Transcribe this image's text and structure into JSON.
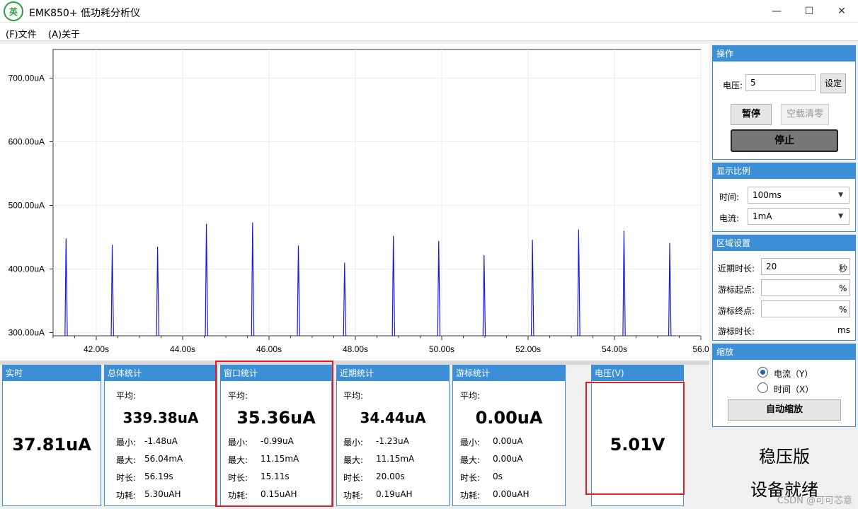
{
  "window": {
    "title": "EMK850+ 低功耗分析仪",
    "logo_text": "英",
    "controls": {
      "minimize": "—",
      "maximize": "☐",
      "close": "✕"
    }
  },
  "menu": {
    "file": "(F)文件",
    "about": "(A)关于"
  },
  "chart_data": {
    "type": "line",
    "title": "",
    "xlabel": "",
    "ylabel": "",
    "y_tick_labels": [
      "700.00uA",
      "600.00uA",
      "500.00uA",
      "400.00uA",
      "300.00uA"
    ],
    "y_ticks": [
      700,
      600,
      500,
      400,
      300
    ],
    "x_tick_labels": [
      "42.00s",
      "44.00s",
      "46.00s",
      "48.00s",
      "50.00s",
      "52.00s",
      "54.00s",
      "56.0"
    ],
    "x_ticks": [
      42,
      44,
      46,
      48,
      50,
      52,
      54,
      56
    ],
    "xlim": [
      41.0,
      56.0
    ],
    "ylim": [
      295,
      745
    ],
    "grid": true,
    "series": [
      {
        "color": "#1a1ad8",
        "baseline": 300,
        "peaks": [
          {
            "x": 41.3,
            "y": 448
          },
          {
            "x": 42.37,
            "y": 438
          },
          {
            "x": 43.42,
            "y": 435
          },
          {
            "x": 44.55,
            "y": 471
          },
          {
            "x": 45.62,
            "y": 473
          },
          {
            "x": 46.68,
            "y": 437
          },
          {
            "x": 47.75,
            "y": 410
          },
          {
            "x": 48.88,
            "y": 452
          },
          {
            "x": 49.93,
            "y": 444
          },
          {
            "x": 50.98,
            "y": 422
          },
          {
            "x": 52.1,
            "y": 446
          },
          {
            "x": 53.17,
            "y": 462
          },
          {
            "x": 54.22,
            "y": 460
          },
          {
            "x": 55.28,
            "y": 441
          }
        ]
      }
    ]
  },
  "stats": {
    "realtime": {
      "header": "实时",
      "value": "37.81uA"
    },
    "total": {
      "header": "总体统计",
      "avg_label": "平均:",
      "avg": "339.38uA",
      "min_label": "最小:",
      "min": "-1.48uA",
      "max_label": "最大:",
      "max": "56.04mA",
      "dur_label": "时长:",
      "dur": "56.19s",
      "energy_label": "功耗:",
      "energy": "5.30uAH"
    },
    "window": {
      "header": "窗口统计",
      "avg_label": "平均:",
      "avg": "35.36uA",
      "min_label": "最小:",
      "min": "-0.99uA",
      "max_label": "最大:",
      "max": "11.15mA",
      "dur_label": "时长:",
      "dur": "15.11s",
      "energy_label": "功耗:",
      "energy": "0.15uAH"
    },
    "recent": {
      "header": "近期统计",
      "avg_label": "平均:",
      "avg": "34.44uA",
      "min_label": "最小:",
      "min": "-1.23uA",
      "max_label": "最大:",
      "max": "11.15mA",
      "dur_label": "时长:",
      "dur": "20.00s",
      "energy_label": "功耗:",
      "energy": "0.19uAH"
    },
    "cursor": {
      "header": "游标统计",
      "avg_label": "平均:",
      "avg": "0.00uA",
      "min_label": "最小:",
      "min": "0.00uA",
      "max_label": "最大:",
      "max": "0.00uA",
      "dur_label": "时长:",
      "dur": "0s",
      "energy_label": "功耗:",
      "energy": "0.00uAH"
    },
    "voltage": {
      "header": "电压(V)",
      "value": "5.01V"
    }
  },
  "operation": {
    "header": "操作",
    "voltage_label": "电压:",
    "voltage_value": "5",
    "set_button": "设定",
    "pause_button": "暂停",
    "zero_button": "空载清零",
    "stop_button": "停止"
  },
  "scale": {
    "header": "显示比例",
    "time_label": "时间:",
    "time_value": "100ms",
    "current_label": "电流:",
    "current_value": "1mA"
  },
  "region": {
    "header": "区域设置",
    "recent_label": "近期时长:",
    "recent_value": "20",
    "recent_unit": "秒",
    "cursor_start_label": "游标起点:",
    "cursor_start_value": "",
    "cursor_start_unit": "%",
    "cursor_end_label": "游标终点:",
    "cursor_end_value": "",
    "cursor_end_unit": "%",
    "cursor_dur_label": "游标时长:",
    "cursor_dur_unit": "ms"
  },
  "zoom": {
    "header": "缩放",
    "current_option": "电流（Y）",
    "time_option": "时间（X）",
    "selected": "current",
    "auto_button": "自动缩放"
  },
  "status": {
    "mode": "稳压版",
    "state": "设备就绪",
    "watermark": "CSDN @可可芯意"
  }
}
